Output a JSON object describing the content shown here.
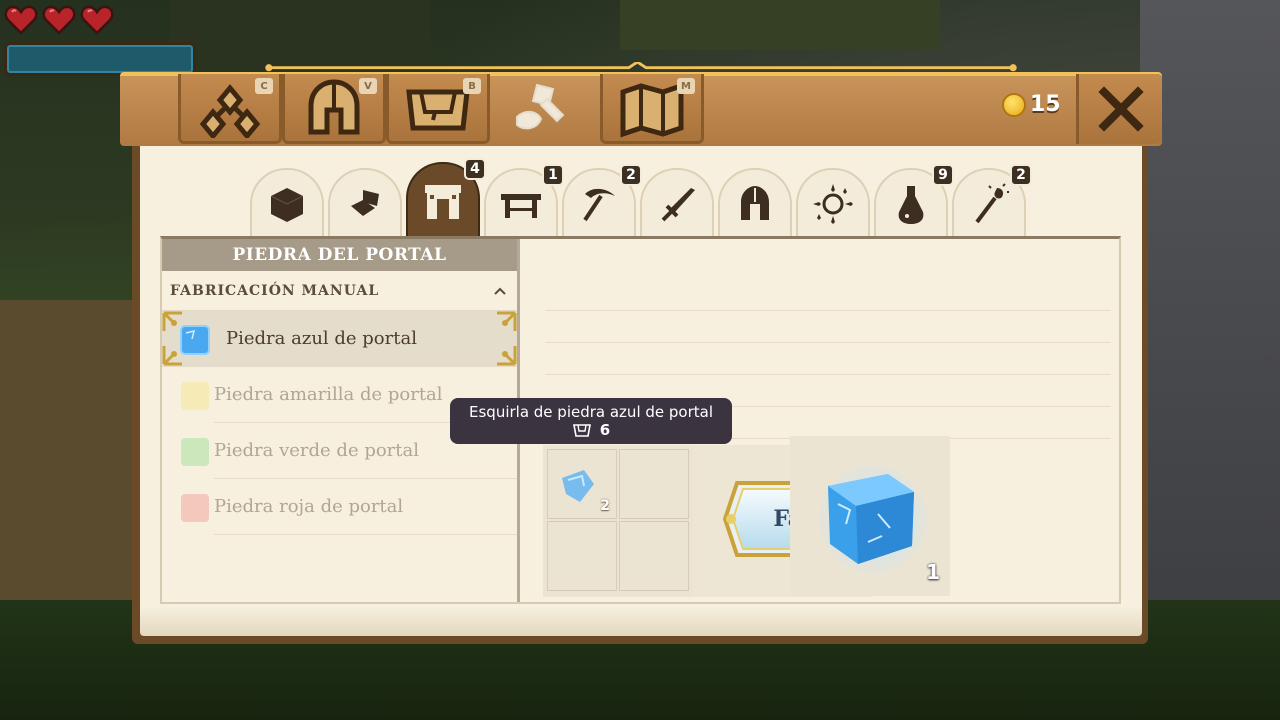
{
  "hud": {
    "hearts": 3,
    "colors": {
      "heart": "#b8242a",
      "bar": "#1f5a6a"
    }
  },
  "top_tabs": [
    {
      "icon": "skills-icon",
      "key": "C",
      "active": false
    },
    {
      "icon": "helmet-icon",
      "key": "V",
      "active": false
    },
    {
      "icon": "bag-icon",
      "key": "B",
      "active": false
    },
    {
      "icon": "crafting-hammer-icon",
      "key": "",
      "active": true
    },
    {
      "icon": "map-icon",
      "key": "M",
      "active": false
    }
  ],
  "coins": "15",
  "category_tabs": [
    {
      "icon": "block-icon",
      "badge": ""
    },
    {
      "icon": "materials-icon",
      "badge": ""
    },
    {
      "icon": "portal-icon",
      "badge": "4",
      "active": true
    },
    {
      "icon": "workbench-icon",
      "badge": "1"
    },
    {
      "icon": "pickaxe-icon",
      "badge": "2"
    },
    {
      "icon": "sword-icon",
      "badge": ""
    },
    {
      "icon": "armor-helmet-icon",
      "badge": ""
    },
    {
      "icon": "sparkle-orb-icon",
      "badge": ""
    },
    {
      "icon": "potion-icon",
      "badge": "9"
    },
    {
      "icon": "magic-staff-icon",
      "badge": "2"
    }
  ],
  "list": {
    "title": "PIEDRA DEL PORTAL",
    "section": "FABRICACIÓN MANUAL",
    "recipes": [
      {
        "label": "Piedra azul de portal",
        "color": "#4aa8f0",
        "selected": true
      },
      {
        "label": "Piedra amarilla de portal",
        "color": "#f3e26a",
        "selected": false
      },
      {
        "label": "Piedra verde de portal",
        "color": "#7fd67a",
        "selected": false
      },
      {
        "label": "Piedra roja de portal",
        "color": "#ef7f7f",
        "selected": false
      }
    ]
  },
  "ingredients": [
    {
      "icon": "blue-portal-shard-icon",
      "count": "2"
    }
  ],
  "craft_button": "Fabricar",
  "result": {
    "icon": "blue-portal-stone-icon",
    "count": "1"
  },
  "tooltip": {
    "title": "Esquirla de piedra azul de portal",
    "owned": "6"
  }
}
